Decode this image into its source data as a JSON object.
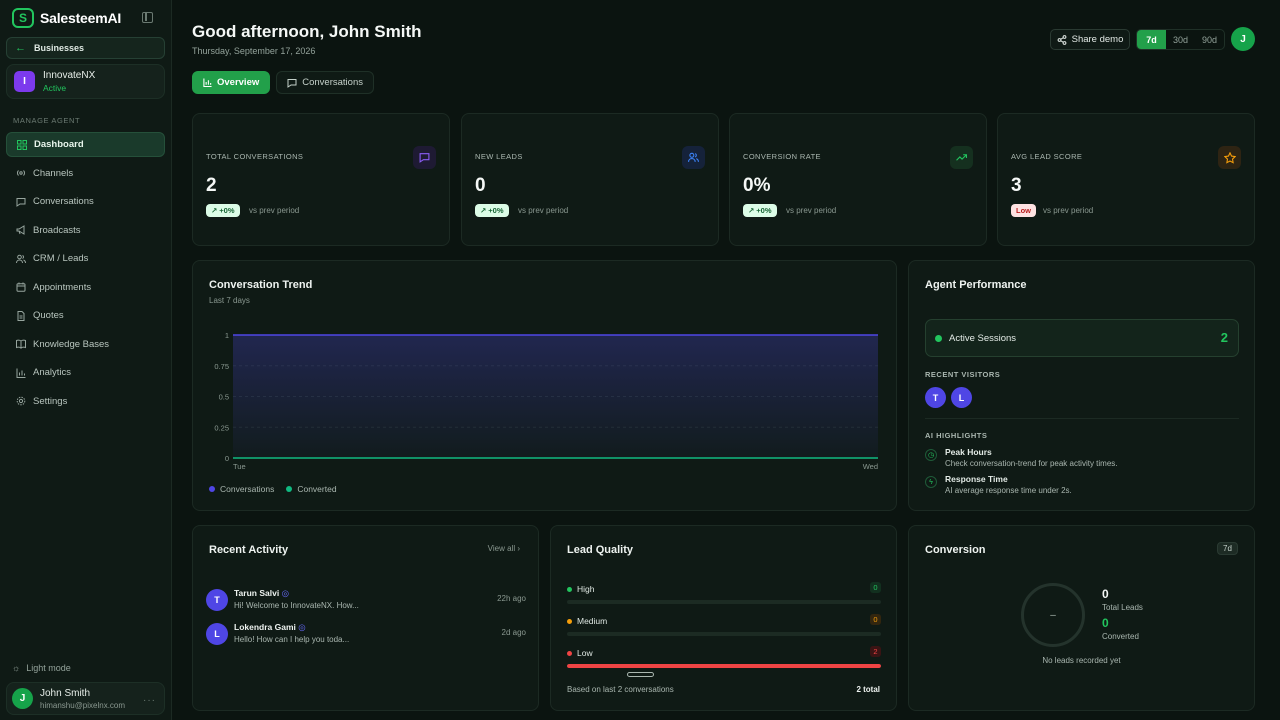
{
  "brand": {
    "name": "SalesteemAI",
    "logo_letter": "S"
  },
  "sidebar": {
    "back_label": "Businesses",
    "org": {
      "initial": "I",
      "name": "InnovateNX",
      "status": "Active"
    },
    "section_label": "MANAGE AGENT",
    "items": [
      {
        "label": "Dashboard",
        "icon": "grid-icon"
      },
      {
        "label": "Channels",
        "icon": "broadcast-icon"
      },
      {
        "label": "Conversations",
        "icon": "chat-icon"
      },
      {
        "label": "Broadcasts",
        "icon": "megaphone-icon"
      },
      {
        "label": "CRM / Leads",
        "icon": "users-icon"
      },
      {
        "label": "Appointments",
        "icon": "calendar-icon"
      },
      {
        "label": "Quotes",
        "icon": "document-icon"
      },
      {
        "label": "Knowledge Bases",
        "icon": "book-icon"
      },
      {
        "label": "Analytics",
        "icon": "bar-chart-icon"
      },
      {
        "label": "Settings",
        "icon": "gear-icon"
      }
    ],
    "light_mode": "Light mode",
    "user": {
      "initial": "J",
      "name": "John Smith",
      "email": "himanshu@pixelnx.com"
    }
  },
  "header": {
    "greeting": "Good afternoon, John Smith",
    "date": "Thursday, September 17, 2026",
    "tabs": [
      "Overview",
      "Conversations"
    ],
    "share_label": "Share demo",
    "ranges": [
      "7d",
      "30d",
      "90d"
    ],
    "avatar": "J"
  },
  "stats": [
    {
      "label": "TOTAL CONVERSATIONS",
      "value": "2",
      "change": "+0%",
      "vs": "vs prev period",
      "color": "#8b5cf6"
    },
    {
      "label": "NEW LEADS",
      "value": "0",
      "change": "+0%",
      "vs": "vs prev period",
      "color": "#3b82f6"
    },
    {
      "label": "CONVERSION RATE",
      "value": "0%",
      "change": "+0%",
      "vs": "vs prev period",
      "color": "#22c55e"
    },
    {
      "label": "AVG LEAD SCORE",
      "value": "3",
      "change": "Low",
      "vs": "vs prev period",
      "color": "#f59e0b"
    }
  ],
  "trend": {
    "title": "Conversation Trend",
    "subtitle": "Last 7 days"
  },
  "chart_data": {
    "type": "area",
    "x": [
      "Tue",
      "Wed"
    ],
    "series": [
      {
        "name": "Conversations",
        "values": [
          1,
          1
        ],
        "color": "#4f46e5"
      },
      {
        "name": "Converted",
        "values": [
          0,
          0
        ],
        "color": "#10b981"
      }
    ],
    "yticks": [
      "1",
      "0.75",
      "0.5",
      "0.25",
      "0"
    ],
    "ylim": [
      0,
      1
    ]
  },
  "agent": {
    "title": "Agent Performance",
    "sessions_label": "Active Sessions",
    "sessions_count": "2",
    "visitors_label": "RECENT VISITORS",
    "visitors": [
      "T",
      "L"
    ],
    "highlights_label": "AI HIGHLIGHTS",
    "highlights": [
      {
        "title": "Peak Hours",
        "desc": "Check conversation-trend for peak activity times."
      },
      {
        "title": "Response Time",
        "desc": "AI average response time under 2s."
      }
    ]
  },
  "activity": {
    "title": "Recent Activity",
    "view_all": "View all",
    "items": [
      {
        "initial": "T",
        "name": "Tarun Salvi",
        "msg": "Hi! Welcome to InnovateNX. How...",
        "time": "22h ago"
      },
      {
        "initial": "L",
        "name": "Lokendra Gami",
        "msg": "Hello! How can I help you toda...",
        "time": "2d ago"
      }
    ]
  },
  "lead_quality": {
    "title": "Lead Quality",
    "rows": [
      {
        "label": "High",
        "count": "0",
        "fraction": 0,
        "color": "#22c55e"
      },
      {
        "label": "Medium",
        "count": "0",
        "fraction": 0,
        "color": "#f59e0b"
      },
      {
        "label": "Low",
        "count": "2",
        "fraction": 1,
        "color": "#ef4444"
      }
    ],
    "footer": "Based on last 2 conversations",
    "total": "2 total"
  },
  "conversion": {
    "title": "Conversion",
    "badge": "7d",
    "ring_text": "–",
    "total_leads": "0",
    "total_leads_label": "Total Leads",
    "converted": "0",
    "converted_label": "Converted",
    "empty": "No leads recorded yet"
  }
}
